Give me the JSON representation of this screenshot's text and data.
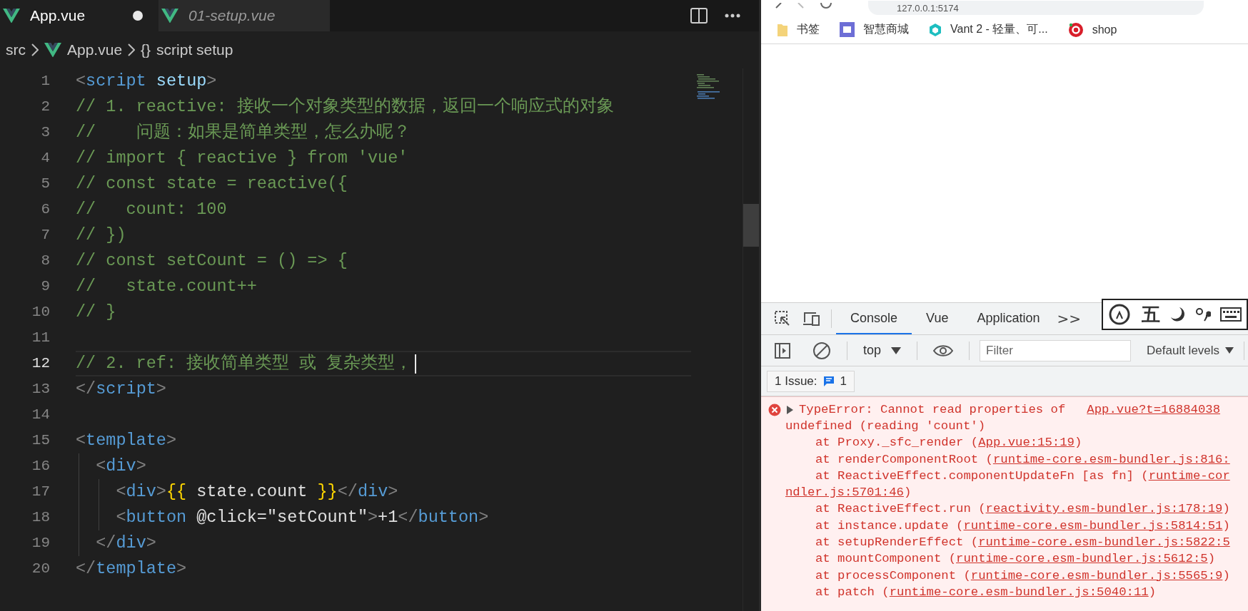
{
  "editor": {
    "tabs": [
      {
        "label": "App.vue",
        "selected": true,
        "modified": true
      },
      {
        "label": "01-setup.vue",
        "selected": false,
        "modified": false
      }
    ],
    "breadcrumbs": [
      {
        "kind": "folder",
        "label": "src"
      },
      {
        "kind": "vue",
        "label": "App.vue"
      },
      {
        "kind": "symbol",
        "symbol": "{}",
        "label": "script setup"
      }
    ],
    "lines": [
      {
        "number": "1",
        "active": false,
        "tokens": [
          {
            "kind": "punct",
            "text": "<"
          },
          {
            "kind": "tag",
            "text": "script"
          },
          {
            "kind": "attr",
            "text": " setup"
          },
          {
            "kind": "punct",
            "text": ">"
          }
        ]
      },
      {
        "number": "2",
        "active": false,
        "tokens": [
          {
            "kind": "comment",
            "text": "// 1. reactive: 接收一个对象类型的数据，返回一个响应式的对象"
          }
        ]
      },
      {
        "number": "3",
        "active": false,
        "tokens": [
          {
            "kind": "comment",
            "text": "//    问题：如果是简单类型，怎么办呢？"
          }
        ]
      },
      {
        "number": "4",
        "active": false,
        "tokens": [
          {
            "kind": "comment",
            "text": "// import { reactive } from 'vue'"
          }
        ]
      },
      {
        "number": "5",
        "active": false,
        "tokens": [
          {
            "kind": "comment",
            "text": "// const state = reactive({"
          }
        ]
      },
      {
        "number": "6",
        "active": false,
        "tokens": [
          {
            "kind": "comment",
            "text": "//   count: 100"
          }
        ]
      },
      {
        "number": "7",
        "active": false,
        "tokens": [
          {
            "kind": "comment",
            "text": "// })"
          }
        ]
      },
      {
        "number": "8",
        "active": false,
        "tokens": [
          {
            "kind": "comment",
            "text": "// const setCount = () => {"
          }
        ]
      },
      {
        "number": "9",
        "active": false,
        "tokens": [
          {
            "kind": "comment",
            "text": "//   state.count++"
          }
        ]
      },
      {
        "number": "10",
        "active": false,
        "tokens": [
          {
            "kind": "comment",
            "text": "// }"
          }
        ]
      },
      {
        "number": "11",
        "active": false
      },
      {
        "number": "12",
        "active": true,
        "tokens": [
          {
            "kind": "comment",
            "text": "// 2. ref: 接收简单类型 或 复杂类型，"
          }
        ]
      },
      {
        "number": "13",
        "active": false,
        "tokens": [
          {
            "kind": "punct",
            "text": "</"
          },
          {
            "kind": "tag",
            "text": "script"
          },
          {
            "kind": "punct",
            "text": ">"
          }
        ]
      },
      {
        "number": "14",
        "active": false
      },
      {
        "number": "15",
        "active": false,
        "tokens": [
          {
            "kind": "punct",
            "text": "<"
          },
          {
            "kind": "tag",
            "text": "template"
          },
          {
            "kind": "punct",
            "text": ">"
          }
        ]
      },
      {
        "number": "16",
        "active": false,
        "tokens": [
          {
            "kind": "punct",
            "text": "  <"
          },
          {
            "kind": "tag",
            "text": "div"
          },
          {
            "kind": "punct",
            "text": ">"
          }
        ]
      },
      {
        "number": "17",
        "active": false,
        "tokens": [
          {
            "kind": "punct",
            "text": "    <"
          },
          {
            "kind": "tag",
            "text": "div"
          },
          {
            "kind": "punct",
            "text": ">"
          },
          {
            "kind": "mustache",
            "text": "{{"
          },
          {
            "kind": "plain",
            "text": " state.count "
          },
          {
            "kind": "mustache",
            "text": "}}"
          },
          {
            "kind": "punct",
            "text": "</"
          },
          {
            "kind": "tag",
            "text": "div"
          },
          {
            "kind": "punct",
            "text": ">"
          }
        ]
      },
      {
        "number": "18",
        "active": false,
        "tokens": [
          {
            "kind": "punct",
            "text": "    <"
          },
          {
            "kind": "tag",
            "text": "button"
          },
          {
            "kind": "plain",
            "text": " @click=\"setCount\""
          },
          {
            "kind": "punct",
            "text": ">"
          },
          {
            "kind": "plain",
            "text": "+1"
          },
          {
            "kind": "punct",
            "text": "</"
          },
          {
            "kind": "tag",
            "text": "button"
          },
          {
            "kind": "punct",
            "text": ">"
          }
        ]
      },
      {
        "number": "19",
        "active": false,
        "tokens": [
          {
            "kind": "punct",
            "text": "  </"
          },
          {
            "kind": "tag",
            "text": "div"
          },
          {
            "kind": "punct",
            "text": ">"
          }
        ]
      },
      {
        "number": "20",
        "active": false,
        "tokens": [
          {
            "kind": "punct",
            "text": "</"
          },
          {
            "kind": "tag",
            "text": "template"
          },
          {
            "kind": "punct",
            "text": ">"
          }
        ]
      }
    ]
  },
  "browser": {
    "address": "127.0.0.1:5174",
    "bookmarks": [
      {
        "kind": "folder",
        "label": "书签"
      },
      {
        "kind": "store",
        "label": "智慧商城"
      },
      {
        "kind": "vant",
        "label": "Vant 2 - 轻量、可..."
      },
      {
        "kind": "shop",
        "label": "shop"
      }
    ]
  },
  "devtools": {
    "tabs": [
      {
        "label": "Console",
        "selected": true
      },
      {
        "label": "Vue",
        "selected": false
      },
      {
        "label": "Application",
        "selected": false
      }
    ],
    "more": ">>",
    "ime": {
      "mode": "五"
    },
    "context": "top",
    "filter": {
      "placeholder": "Filter"
    },
    "levels": "Default levels",
    "issues": {
      "label": "1 Issue:",
      "count": "1"
    },
    "error": {
      "head": "TypeError: Cannot read properties of",
      "source": "App.vue?t=16884038",
      "message": "undefined (reading 'count')",
      "frames": [
        {
          "kind": "frame",
          "text": "at Proxy._sfc_render (",
          "link": "App.vue:15:19",
          "tail": ")"
        },
        {
          "kind": "frame",
          "text": "at renderComponentRoot (",
          "link": "runtime-core.esm-bundler.js:816:"
        },
        {
          "kind": "frame",
          "text": "at ReactiveEffect.componentUpdateFn [as fn] (",
          "link": "runtime-cor"
        },
        {
          "kind": "wrap",
          "link": "ndler.js:5701:46",
          "tail": ")"
        },
        {
          "kind": "frame",
          "text": "at ReactiveEffect.run (",
          "link": "reactivity.esm-bundler.js:178:19",
          "tail": ")"
        },
        {
          "kind": "frame",
          "text": "at instance.update (",
          "link": "runtime-core.esm-bundler.js:5814:51",
          "tail": ")"
        },
        {
          "kind": "frame",
          "text": "at setupRenderEffect (",
          "link": "runtime-core.esm-bundler.js:5822:5"
        },
        {
          "kind": "frame",
          "text": "at mountComponent (",
          "link": "runtime-core.esm-bundler.js:5612:5",
          "tail": ")"
        },
        {
          "kind": "frame",
          "text": "at processComponent (",
          "link": "runtime-core.esm-bundler.js:5565:9",
          "tail": ")"
        },
        {
          "kind": "frame",
          "text": "at patch (",
          "link": "runtime-core.esm-bundler.js:5040:11",
          "tail": ")"
        }
      ]
    }
  }
}
